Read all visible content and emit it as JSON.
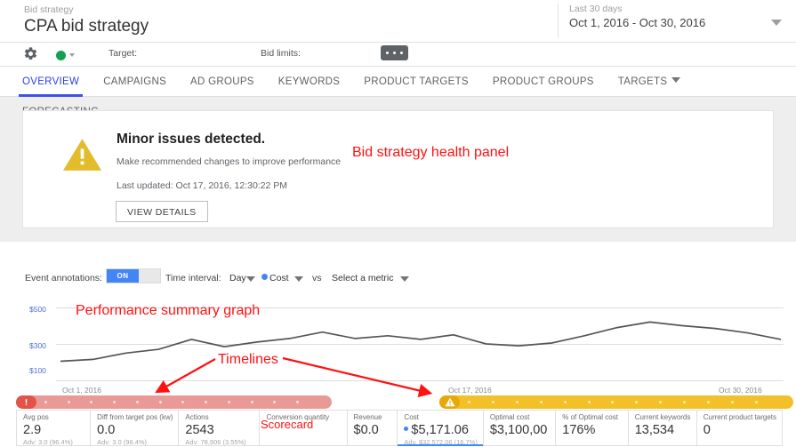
{
  "header": {
    "eyebrow": "Bid strategy",
    "title": "CPA bid strategy",
    "date_range_label": "Last 30 days",
    "date_range_value": "Oct 1, 2016 - Oct 30, 2016"
  },
  "settings": {
    "target_label": "Target:",
    "bid_limits_label": "Bid limits:",
    "status_color": "#13a054"
  },
  "tabs": [
    {
      "label": "OVERVIEW",
      "active": true,
      "caret": false
    },
    {
      "label": "CAMPAIGNS",
      "active": false,
      "caret": false
    },
    {
      "label": "AD GROUPS",
      "active": false,
      "caret": false
    },
    {
      "label": "KEYWORDS",
      "active": false,
      "caret": false
    },
    {
      "label": "PRODUCT TARGETS",
      "active": false,
      "caret": false
    },
    {
      "label": "PRODUCT GROUPS",
      "active": false,
      "caret": false
    },
    {
      "label": "TARGETS",
      "active": false,
      "caret": true
    },
    {
      "label": "FORECASTING",
      "active": false,
      "caret": false
    }
  ],
  "health_panel": {
    "title": "Minor issues detected.",
    "subtitle": "Make recommended changes to improve performance",
    "last_updated": "Last updated: Oct 17, 2016, 12:30:22 PM",
    "button_label": "VIEW DETAILS",
    "warning_color": "#e3bc2c"
  },
  "annotations": {
    "health_panel": "Bid strategy health panel",
    "performance_graph": "Performance summary graph",
    "timelines": "Timelines",
    "scorecard": "Scorecard",
    "color": "#ff1111"
  },
  "controls": {
    "event_annotations_label": "Event annotations:",
    "toggle_state": "ON",
    "time_interval_label": "Time interval:",
    "time_interval_value": "Day",
    "metric_primary": "Cost",
    "vs_label": "vs",
    "metric_secondary": "Select a metric"
  },
  "chart_data": {
    "type": "line",
    "title": "Performance summary graph",
    "xlabel": "",
    "ylabel": "",
    "ylim": [
      0,
      600
    ],
    "yticks": [
      100,
      300,
      500
    ],
    "ytick_labels": [
      "$100",
      "$300",
      "$500"
    ],
    "grid": true,
    "legend": "none",
    "x_axis_start_label": "Oct 1, 2016",
    "x_axis_mid_label": "Oct 17, 2016",
    "x_axis_end_label": "Oct 30, 2016",
    "series": [
      {
        "name": "Cost",
        "color": "#555555",
        "values": [
          205,
          215,
          250,
          270,
          325,
          285,
          310,
          330,
          365,
          330,
          345,
          325,
          350,
          300,
          290,
          305,
          345,
          390,
          420,
          400,
          385,
          360,
          325
        ]
      }
    ]
  },
  "timelines": [
    {
      "name": "issue-timeline",
      "status": "error",
      "color": "#ea9a96",
      "badge_color": "#e35347",
      "badge_icon": "exclamation-circle-icon",
      "start_label": "Oct 1, 2016"
    },
    {
      "name": "warning-timeline",
      "status": "warning",
      "color": "#f3c02a",
      "badge_color": "#e8a908",
      "badge_icon": "warning-triangle-icon",
      "start_label": "Oct 17, 2016",
      "end_label": "Oct 30, 2016"
    }
  ],
  "scorecard": [
    {
      "label": "Avg pos",
      "value": "2.9",
      "sub": "Adv: 3.0 (96.4%)",
      "width": 93,
      "selected": false,
      "dot": false
    },
    {
      "label": "Diff from target pos (kw)",
      "value": "0.0",
      "sub": "Adv: 3.0 (96.4%)",
      "width": 100,
      "selected": false,
      "dot": false
    },
    {
      "label": "Actions",
      "value": "2543",
      "sub": "Adv: 78,906 (3.55%)",
      "width": 102,
      "selected": false,
      "dot": false
    },
    {
      "label": "Conversion quantity",
      "value": "",
      "sub": "",
      "width": 110,
      "selected": false,
      "dot": false
    },
    {
      "label": "Revenue",
      "value": "$0.0",
      "sub": "",
      "width": 63,
      "selected": false,
      "dot": false
    },
    {
      "label": "Cost",
      "value": "$5,171.06",
      "sub": "Adv. $32,572.06 (16.7%)",
      "width": 107,
      "selected": true,
      "dot": true
    },
    {
      "label": "Optimal cost",
      "value": "$3,100,00",
      "sub": "",
      "width": 91,
      "selected": false,
      "dot": false
    },
    {
      "label": "% of Optimal cost",
      "value": "176%",
      "sub": "",
      "width": 91,
      "selected": false,
      "dot": false
    },
    {
      "label": "Current keywords",
      "value": "13,534",
      "sub": "",
      "width": 86,
      "selected": false,
      "dot": false
    },
    {
      "label": "Current product targets",
      "value": "0",
      "sub": "",
      "width": 96,
      "selected": false,
      "dot": false
    }
  ]
}
